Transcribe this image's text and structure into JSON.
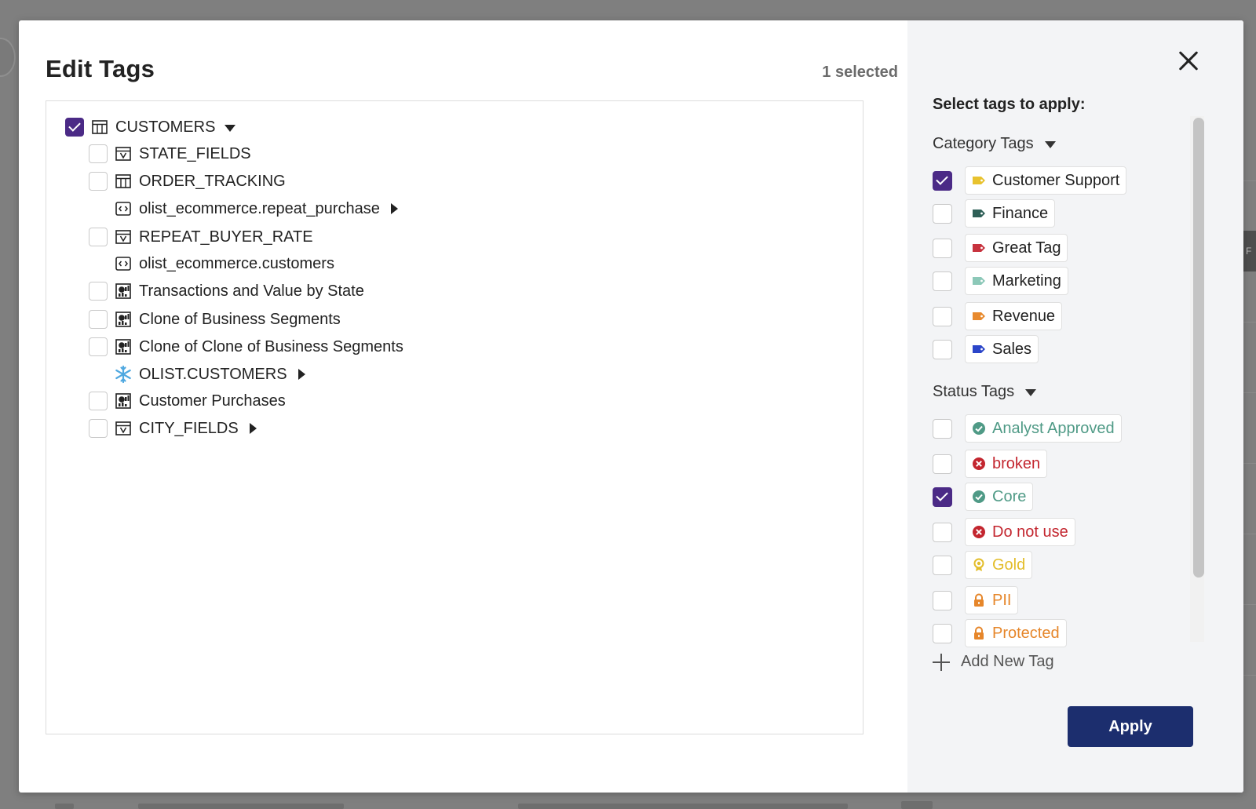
{
  "modal": {
    "title": "Edit Tags",
    "selected_count": "1 selected"
  },
  "tree": {
    "items": [
      {
        "label": "CUSTOMERS",
        "checked": true,
        "icon": "table-icon",
        "toggle": "expanded"
      },
      {
        "label": "STATE_FIELDS",
        "checked": false,
        "icon": "view-icon"
      },
      {
        "label": "ORDER_TRACKING",
        "checked": false,
        "icon": "table-icon"
      },
      {
        "label": "olist_ecommerce.repeat_purchase",
        "checkbox": false,
        "icon": "code-icon",
        "toggle": "collapsed"
      },
      {
        "label": "REPEAT_BUYER_RATE",
        "checked": false,
        "icon": "view-icon"
      },
      {
        "label": "olist_ecommerce.customers",
        "checkbox": false,
        "icon": "code-icon"
      },
      {
        "label": "Transactions and Value by State",
        "checked": false,
        "icon": "dashboard-icon"
      },
      {
        "label": "Clone of Business Segments",
        "checked": false,
        "icon": "dashboard-icon"
      },
      {
        "label": "Clone of Clone of Business Segments",
        "checked": false,
        "icon": "dashboard-icon"
      },
      {
        "label": "OLIST.CUSTOMERS",
        "checkbox": false,
        "icon": "snowflake-icon",
        "toggle": "collapsed"
      },
      {
        "label": "Customer Purchases",
        "checked": false,
        "icon": "dashboard-icon"
      },
      {
        "label": "CITY_FIELDS",
        "checked": false,
        "icon": "view-icon",
        "toggle": "collapsed"
      }
    ]
  },
  "tags_panel": {
    "heading": "Select tags to apply:",
    "category_group": {
      "label": "Category Tags",
      "tags": [
        {
          "label": "Customer Support",
          "checked": true,
          "color": "#e8c22e"
        },
        {
          "label": "Finance",
          "checked": false,
          "color": "#2f5f57"
        },
        {
          "label": "Great Tag",
          "checked": false,
          "color": "#c7333e"
        },
        {
          "label": "Marketing",
          "checked": false,
          "color": "#8cc8b8"
        },
        {
          "label": "Revenue",
          "checked": false,
          "color": "#e88a2e"
        },
        {
          "label": "Sales",
          "checked": false,
          "color": "#2b45c9"
        }
      ]
    },
    "status_group": {
      "label": "Status Tags",
      "tags": [
        {
          "label": "Analyst Approved",
          "checked": false,
          "color": "#4f9a86",
          "icon": "check-circle-icon"
        },
        {
          "label": "broken",
          "checked": false,
          "color": "#c3262f",
          "icon": "x-circle-icon"
        },
        {
          "label": "Core",
          "checked": true,
          "color": "#4f9a86",
          "icon": "check-circle-icon"
        },
        {
          "label": "Do not use",
          "checked": false,
          "color": "#c3262f",
          "icon": "x-circle-icon"
        },
        {
          "label": "Gold",
          "checked": false,
          "color": "#e3bd2a",
          "icon": "award-icon"
        },
        {
          "label": "PII",
          "checked": false,
          "color": "#e6862a",
          "icon": "lock-icon"
        },
        {
          "label": "Protected",
          "checked": false,
          "color": "#e6862a",
          "icon": "lock-icon"
        }
      ]
    },
    "add_new_label": "Add New Tag",
    "apply_label": "Apply"
  },
  "colors": {
    "accent_purple": "#4b2a86",
    "apply_button": "#1c2e6e",
    "panel_bg": "#f3f4f6"
  }
}
